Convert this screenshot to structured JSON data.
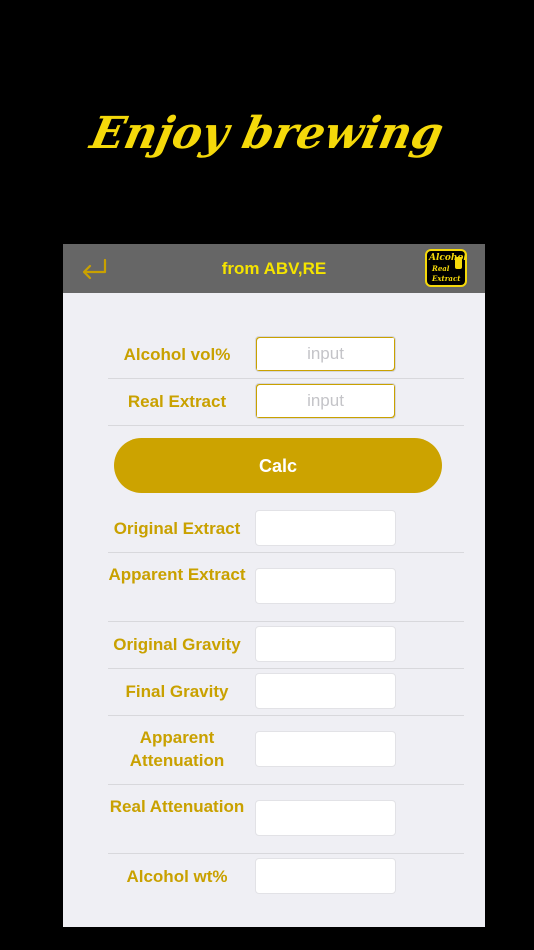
{
  "promo": {
    "headline": "Enjoy brewing"
  },
  "navbar": {
    "title": "from ABV,RE",
    "logo_text": [
      "Alcohol",
      "Real",
      "Extract"
    ]
  },
  "inputs": [
    {
      "label": "Alcohol vol%",
      "placeholder": "input",
      "value": ""
    },
    {
      "label": "Real Extract",
      "placeholder": "input",
      "value": ""
    }
  ],
  "calc_button": {
    "label": "Calc"
  },
  "results": [
    {
      "label": "Original Extract",
      "value": ""
    },
    {
      "label": "Apparent Extract",
      "value": ""
    },
    {
      "label": "Original Gravity",
      "value": ""
    },
    {
      "label": "Final Gravity",
      "value": ""
    },
    {
      "label": "Apparent Attenuation",
      "value": ""
    },
    {
      "label": "Real Attenuation",
      "value": ""
    },
    {
      "label": "Alcohol wt%",
      "value": ""
    }
  ],
  "colors": {
    "accent": "#CCA300",
    "title_yellow": "#F5E400",
    "background": "#000000",
    "panel": "#EFEFF4",
    "navbar": "#666666"
  },
  "icons": {
    "back": "return-arrow-icon",
    "logo": "beer-glass-icon"
  }
}
